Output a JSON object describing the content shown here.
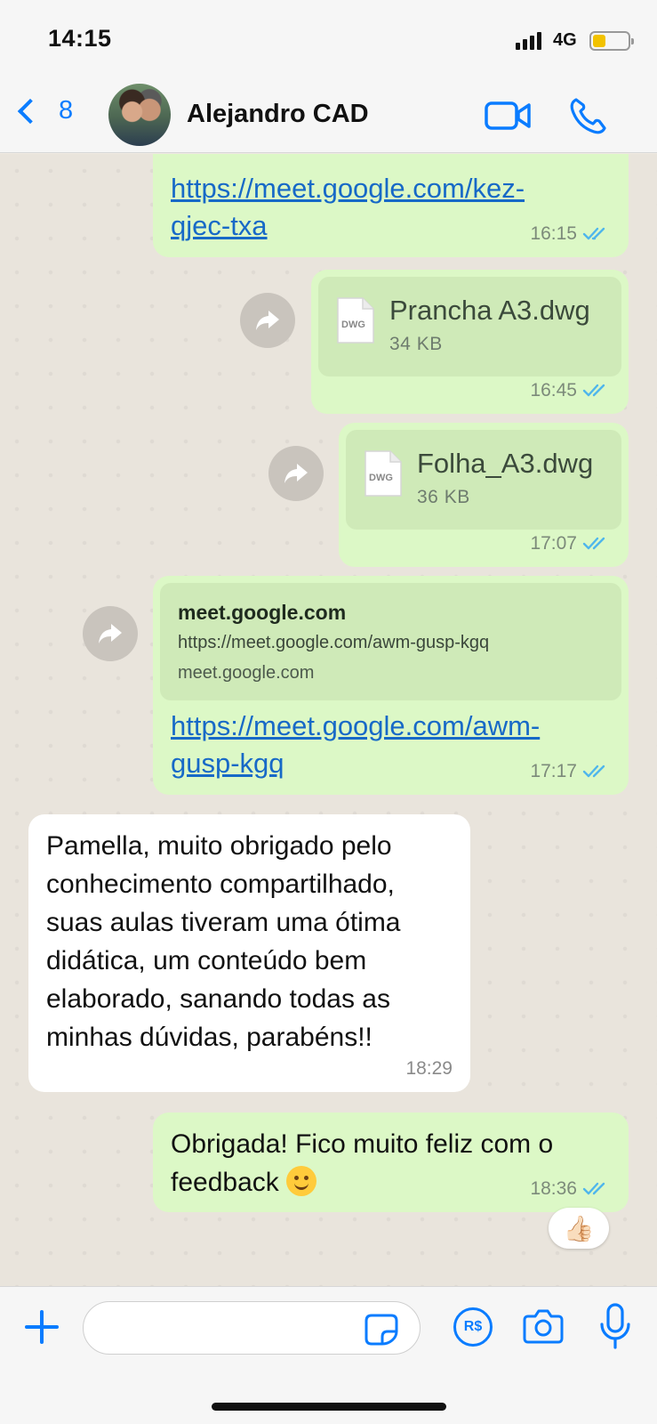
{
  "status_bar": {
    "time": "14:15",
    "network": "4G"
  },
  "header": {
    "back_count": "8",
    "contact_name": "Alejandro CAD"
  },
  "messages": [
    {
      "link_line1": "https://meet.google.com/kez-",
      "link_line2": "qjec-txa",
      "time": "16:15"
    },
    {
      "file_badge": "DWG",
      "file_name": "Prancha A3.dwg",
      "file_size": "34 KB",
      "time": "16:45"
    },
    {
      "file_badge": "DWG",
      "file_name": "Folha_A3.dwg",
      "file_size": "36 KB",
      "time": "17:07"
    },
    {
      "preview_title": "meet.google.com",
      "preview_url": "https://meet.google.com/awm-gusp-kgq",
      "preview_domain": "meet.google.com",
      "link_line1": "https://meet.google.com/awm-",
      "link_line2": "gusp-kgq",
      "time": "17:17"
    },
    {
      "lines": [
        "Pamella, muito obrigado pelo",
        "conhecimento compartilhado,",
        "suas aulas tiveram uma ótima",
        "didática, um conteúdo bem",
        "elaborado, sanando todas as",
        "minhas dúvidas, parabéns!!"
      ],
      "time": "18:29"
    },
    {
      "line1": "Obrigada! Fico muito feliz com o",
      "line2": "feedback",
      "emoji": "smiling-face",
      "time": "18:36",
      "reaction": "👍🏻"
    }
  ],
  "input": {
    "placeholder": "",
    "pay_label": "R$"
  },
  "colors": {
    "accent": "#0a7cff",
    "outgoing_bubble": "#dcf8c6",
    "incoming_bubble": "#ffffff",
    "read_ticks": "#4fb6ec",
    "link": "#1769c7"
  }
}
